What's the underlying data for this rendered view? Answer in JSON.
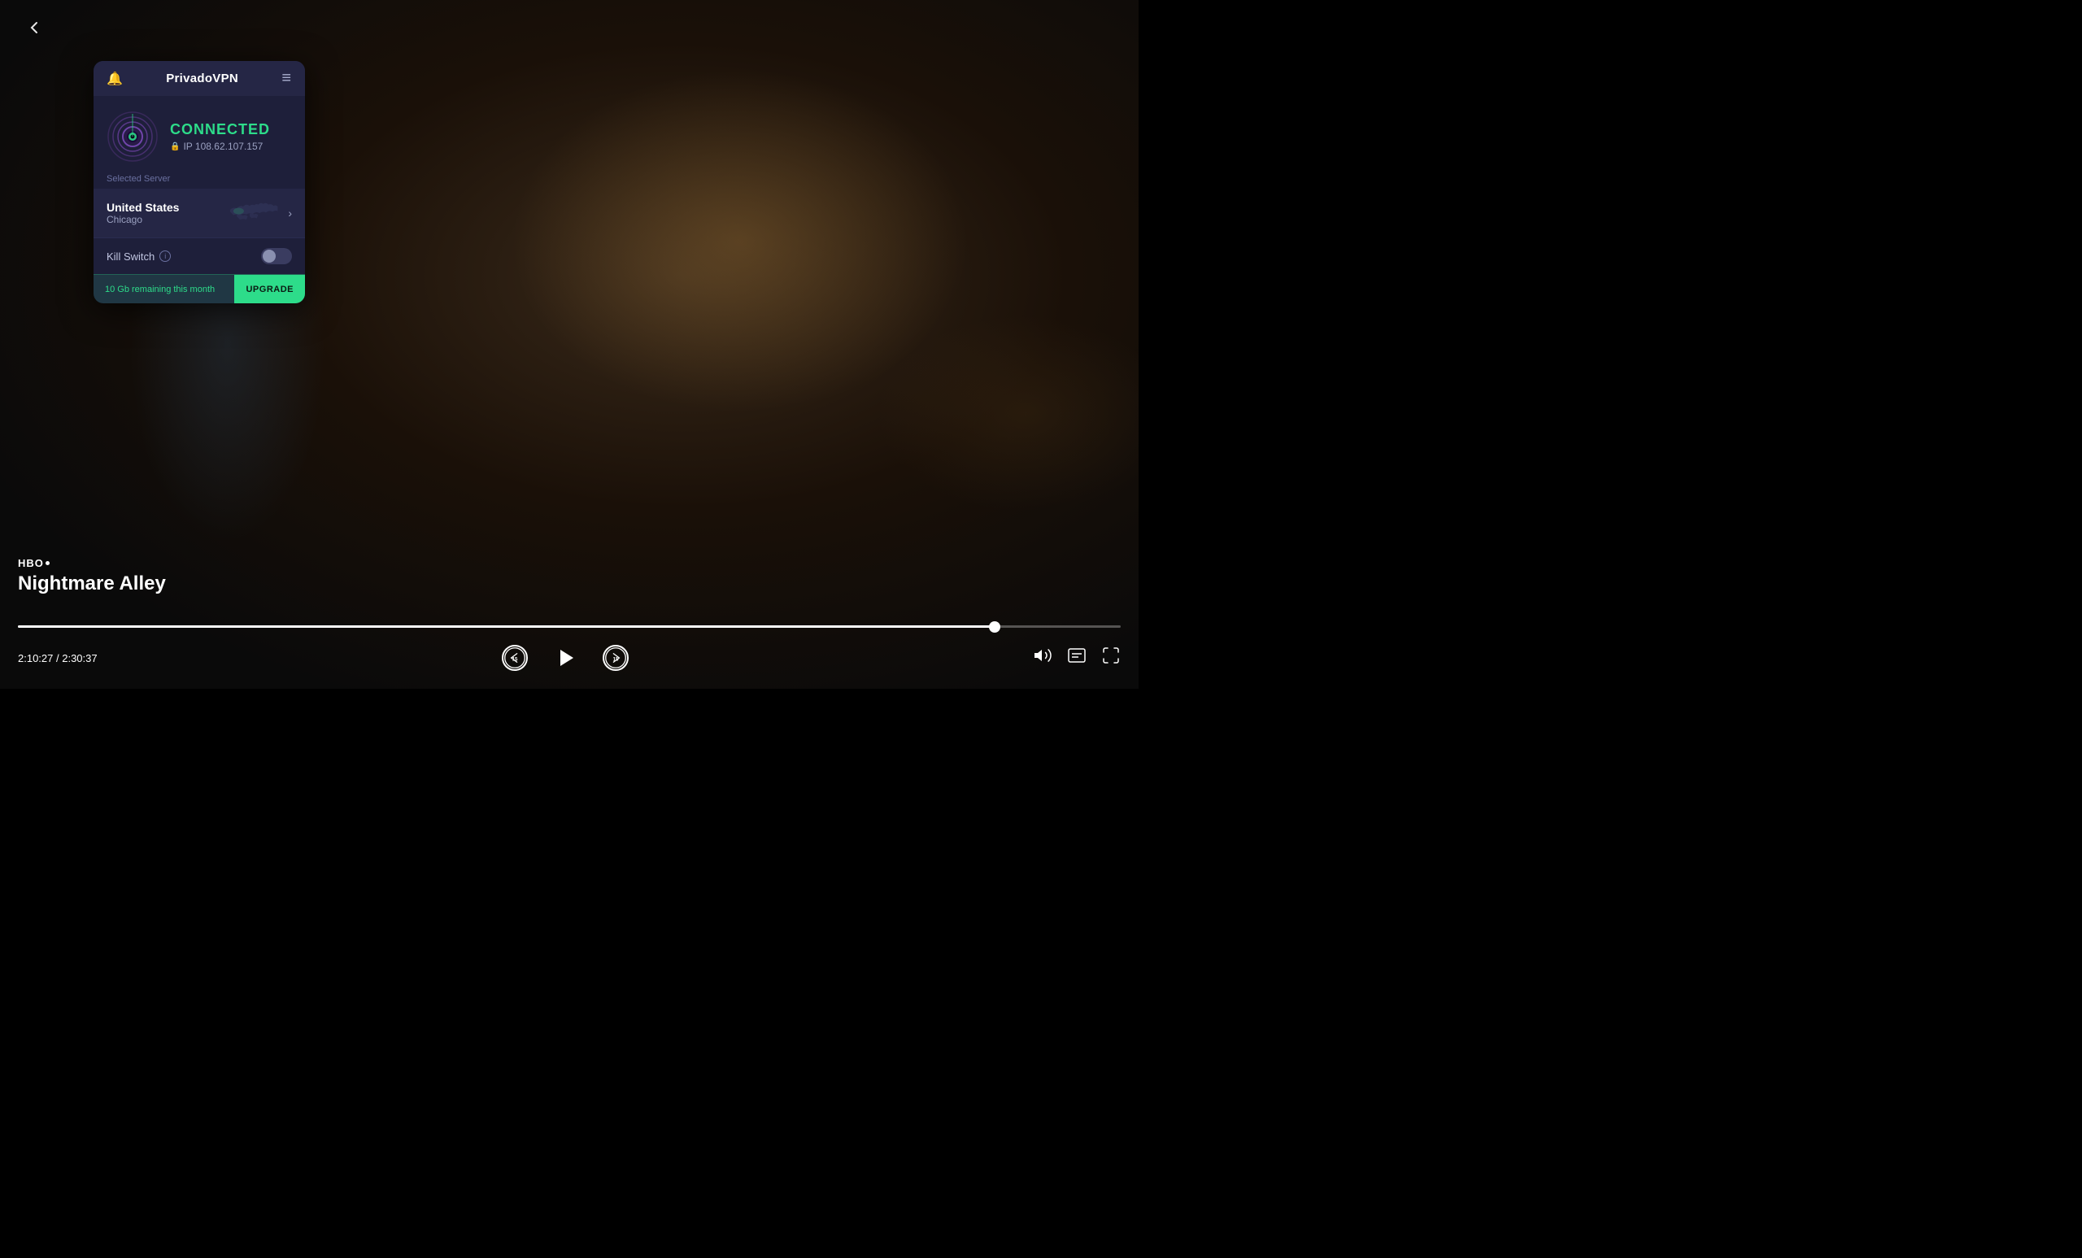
{
  "app": {
    "title": "PrivadoVPN",
    "back_label": "‹"
  },
  "vpn": {
    "header": {
      "title": "PrivadoVPN",
      "bell_icon": "🔔",
      "menu_icon": "≡"
    },
    "status": {
      "text": "CONNECTED",
      "ip_label": "IP 108.62.107.157"
    },
    "server": {
      "label": "Selected Server",
      "country": "United States",
      "city": "Chicago",
      "chevron": "›"
    },
    "kill_switch": {
      "label": "Kill Switch",
      "info": "i"
    },
    "footer": {
      "remaining": "10 Gb remaining this month",
      "upgrade": "UPGRADE"
    }
  },
  "player": {
    "service": "HBO",
    "title": "Nightmare Alley",
    "current_time": "2:10:27",
    "total_time": "2:30:37",
    "time_separator": " / ",
    "progress_percent": 88.6,
    "skip_back": "15",
    "skip_forward": "15"
  }
}
